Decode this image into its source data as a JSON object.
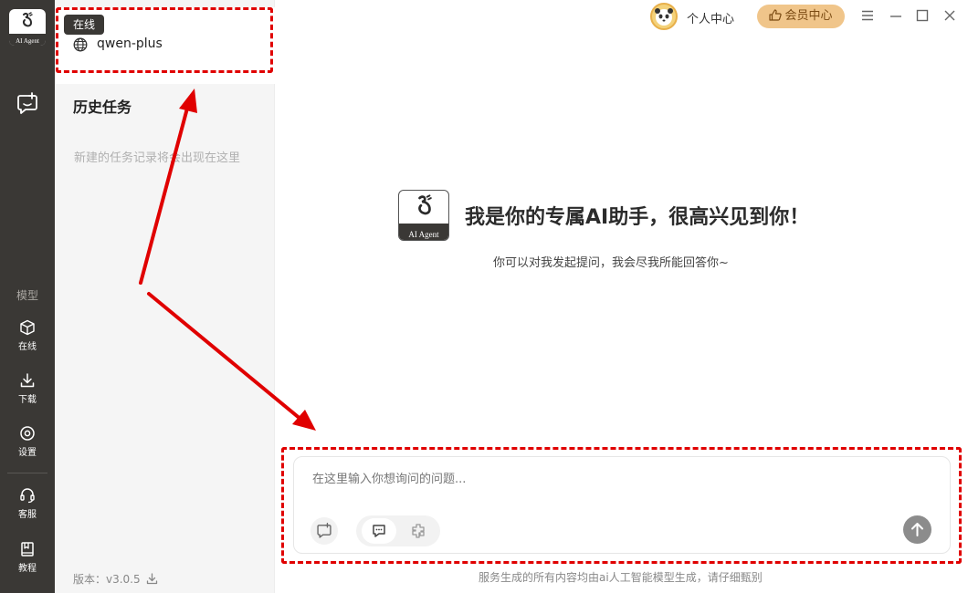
{
  "app": {
    "logo_text": "AI Agent",
    "accent_color": "#3a3835",
    "vip_color": "#f0c58a",
    "highlight_color": "#e00000"
  },
  "rail": {
    "new_chat_icon": "chat-plus-icon",
    "section_label": "模型",
    "items": [
      {
        "label": "在线",
        "icon": "cube-icon"
      },
      {
        "label": "下载",
        "icon": "download-icon"
      },
      {
        "label": "设置",
        "icon": "gear-icon"
      },
      {
        "label": "客服",
        "icon": "headset-icon"
      },
      {
        "label": "教程",
        "icon": "book-icon"
      }
    ]
  },
  "sidebar": {
    "online_tag": "在线",
    "model_name": "qwen-plus",
    "history_title": "历史任务",
    "history_empty": "新建的任务记录将会出现在这里",
    "version": "版本：v3.0.5"
  },
  "topbar": {
    "personal_center": "个人中心",
    "vip_center": "会员中心",
    "window_controls": [
      "menu-icon",
      "minimize-icon",
      "maximize-icon",
      "close-icon"
    ]
  },
  "welcome": {
    "title": "我是你的专属AI助手，很高兴见到你！",
    "subtitle": "你可以对我发起提问，我会尽我所能回答你~",
    "logo_text": "AI Agent"
  },
  "composer": {
    "placeholder": "在这里输入你想询问的问题...",
    "value": ""
  },
  "footer": {
    "disclaimer": "服务生成的所有内容均由ai人工智能模型生成，请仔细甄别"
  }
}
